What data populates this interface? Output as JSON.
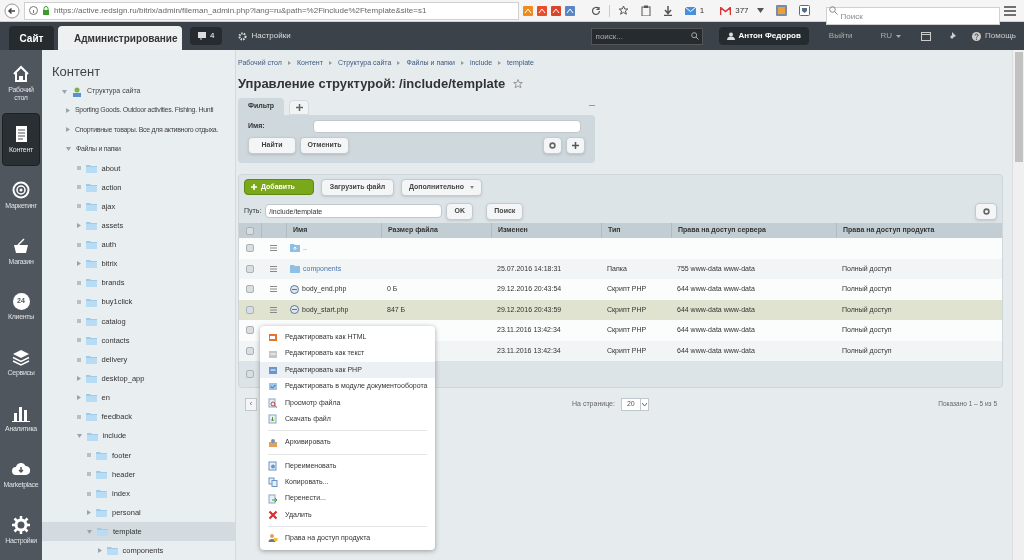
{
  "browser": {
    "url": "https://active.redsign.ru/bitrix/admin/fileman_admin.php?lang=ru&path=%2Finclude%2Ftemplate&site=s1",
    "mail_count": "1",
    "gmail_count": "377",
    "search_placeholder": "Поиск"
  },
  "admin_bar": {
    "tabs": [
      {
        "label": "Сайт",
        "selected": false
      },
      {
        "label": "Администрирование",
        "selected": true
      }
    ],
    "notifications": "4",
    "settings": "Настройки",
    "search_placeholder": "поиск...",
    "user": "Антон Федоров",
    "logout": "Выйти",
    "language": "RU",
    "help": "Помощь"
  },
  "nav": [
    {
      "label": "Рабочий стол",
      "selected": false
    },
    {
      "label": "Контент",
      "selected": true
    },
    {
      "label": "Маркетинг",
      "selected": false
    },
    {
      "label": "Магазин",
      "selected": false
    },
    {
      "label": "Клиенты",
      "selected": false,
      "icon_text": "24"
    },
    {
      "label": "Сервисы",
      "selected": false
    },
    {
      "label": "Аналитика",
      "selected": false
    },
    {
      "label": "Marketplace",
      "selected": false
    },
    {
      "label": "Настройки",
      "selected": false
    }
  ],
  "tree": {
    "title": "Контент",
    "items": [
      {
        "label": "Структура сайта",
        "kind": "site",
        "expanded": true,
        "selected": false,
        "children": [
          {
            "label": "Sporting Goods. Outdoor activities. Fishing. Hunti",
            "kind": "section",
            "expanded": false,
            "selected": false
          },
          {
            "label": "Спортивные товары. Все для активного отдыха.",
            "kind": "section",
            "expanded": false,
            "selected": false
          },
          {
            "label": "Файлы и папки",
            "kind": "section",
            "expanded": true,
            "selected": false,
            "children": [
              {
                "label": "about",
                "kind": "folder",
                "selected": false
              },
              {
                "label": "action",
                "kind": "folder",
                "selected": false
              },
              {
                "label": "ajax",
                "kind": "folder",
                "selected": false
              },
              {
                "label": "assets",
                "kind": "folder",
                "expanded": false,
                "selected": false
              },
              {
                "label": "auth",
                "kind": "folder",
                "selected": false
              },
              {
                "label": "bitrix",
                "kind": "folder",
                "expanded": false,
                "selected": false
              },
              {
                "label": "brands",
                "kind": "folder",
                "selected": false
              },
              {
                "label": "buy1click",
                "kind": "folder",
                "selected": false
              },
              {
                "label": "catalog",
                "kind": "folder",
                "selected": false
              },
              {
                "label": "contacts",
                "kind": "folder",
                "selected": false
              },
              {
                "label": "delivery",
                "kind": "folder",
                "selected": false
              },
              {
                "label": "desktop_app",
                "kind": "folder",
                "expanded": false,
                "selected": false
              },
              {
                "label": "en",
                "kind": "folder",
                "expanded": false,
                "selected": false
              },
              {
                "label": "feedback",
                "kind": "folder",
                "selected": false
              },
              {
                "label": "include",
                "kind": "folder",
                "expanded": true,
                "selected": false,
                "children": [
                  {
                    "label": "footer",
                    "kind": "folder",
                    "selected": false
                  },
                  {
                    "label": "header",
                    "kind": "folder",
                    "selected": false
                  },
                  {
                    "label": "index",
                    "kind": "folder",
                    "selected": false
                  },
                  {
                    "label": "personal",
                    "kind": "folder",
                    "expanded": false,
                    "selected": false
                  },
                  {
                    "label": "template",
                    "kind": "folder",
                    "expanded": true,
                    "selected": true,
                    "children": [
                      {
                        "label": "components",
                        "kind": "folder",
                        "expanded": false,
                        "selected": false
                      }
                    ]
                  }
                ]
              }
            ]
          }
        ]
      }
    ]
  },
  "breadcrumbs": [
    "Рабочий стол",
    "Контент",
    "Структура сайта",
    "Файлы и папки",
    "include",
    "template"
  ],
  "title": "Управление структурой: /include/template",
  "filter": {
    "tab": "Фильтр",
    "name_label": "Имя:",
    "find": "Найти",
    "cancel": "Отменить"
  },
  "toolbar": {
    "add": "Добавить",
    "upload": "Загрузить файл",
    "more": "Дополнительно",
    "path_label": "Путь:",
    "path": "/include/template",
    "ok": "OK",
    "search": "Поиск"
  },
  "table": {
    "all_checked": false,
    "columns": [
      "Имя",
      "Размер файла",
      "Изменен",
      "Тип",
      "Права на доступ сервера",
      "Права на доступ продукта"
    ],
    "rows": [
      {
        "kind": "up",
        "name": "..",
        "selected": false,
        "checked": false
      },
      {
        "kind": "folder",
        "name": "components",
        "size": "",
        "modified": "25.07.2016 14:18:31",
        "type": "Папка",
        "server": "755 www-data www-data",
        "product": "Полный доступ",
        "selected": false,
        "checked": false
      },
      {
        "kind": "file",
        "name": "body_end.php",
        "size": "0 Б",
        "modified": "29.12.2016 20:43:54",
        "type": "Скрипт PHP",
        "server": "644 www-data www-data",
        "product": "Полный доступ",
        "selected": false,
        "checked": false
      },
      {
        "kind": "file",
        "name": "body_start.php",
        "size": "847 Б",
        "modified": "29.12.2016 20:43:59",
        "type": "Скрипт PHP",
        "server": "644 www-data www-data",
        "product": "Полный доступ",
        "selected": true,
        "checked": false
      },
      {
        "kind": "hidden",
        "modified": "23.11.2016 13:42:34",
        "type": "Скрипт PHP",
        "server": "644 www-data www-data",
        "product": "Полный доступ",
        "selected": false,
        "checked": false
      },
      {
        "kind": "hidden",
        "modified": "23.11.2016 13:42:34",
        "type": "Скрипт PHP",
        "server": "644 www-data www-data",
        "product": "Полный доступ",
        "selected": false,
        "checked": false
      }
    ]
  },
  "pager": {
    "prev": "‹",
    "per_page_label": "На странице:",
    "per_page": "20",
    "shown": "Показано 1 – 5 из 5"
  },
  "context_menu": [
    [
      {
        "label": "Редактировать как HTML",
        "selected": false
      },
      {
        "label": "Редактировать как текст",
        "selected": false
      },
      {
        "label": "Редактировать как PHP",
        "selected": true
      },
      {
        "label": "Редактировать в модуле документооборота",
        "selected": false
      },
      {
        "label": "Просмотр файла",
        "selected": false
      },
      {
        "label": "Скачать файл",
        "selected": false
      }
    ],
    [
      {
        "label": "Архивировать",
        "selected": false
      }
    ],
    [
      {
        "label": "Переименовать",
        "selected": false
      },
      {
        "label": "Копировать...",
        "selected": false
      },
      {
        "label": "Перенести...",
        "selected": false
      },
      {
        "label": "Удалить",
        "selected": false
      }
    ],
    [
      {
        "label": "Права на доступ продукта",
        "selected": false
      }
    ]
  ]
}
